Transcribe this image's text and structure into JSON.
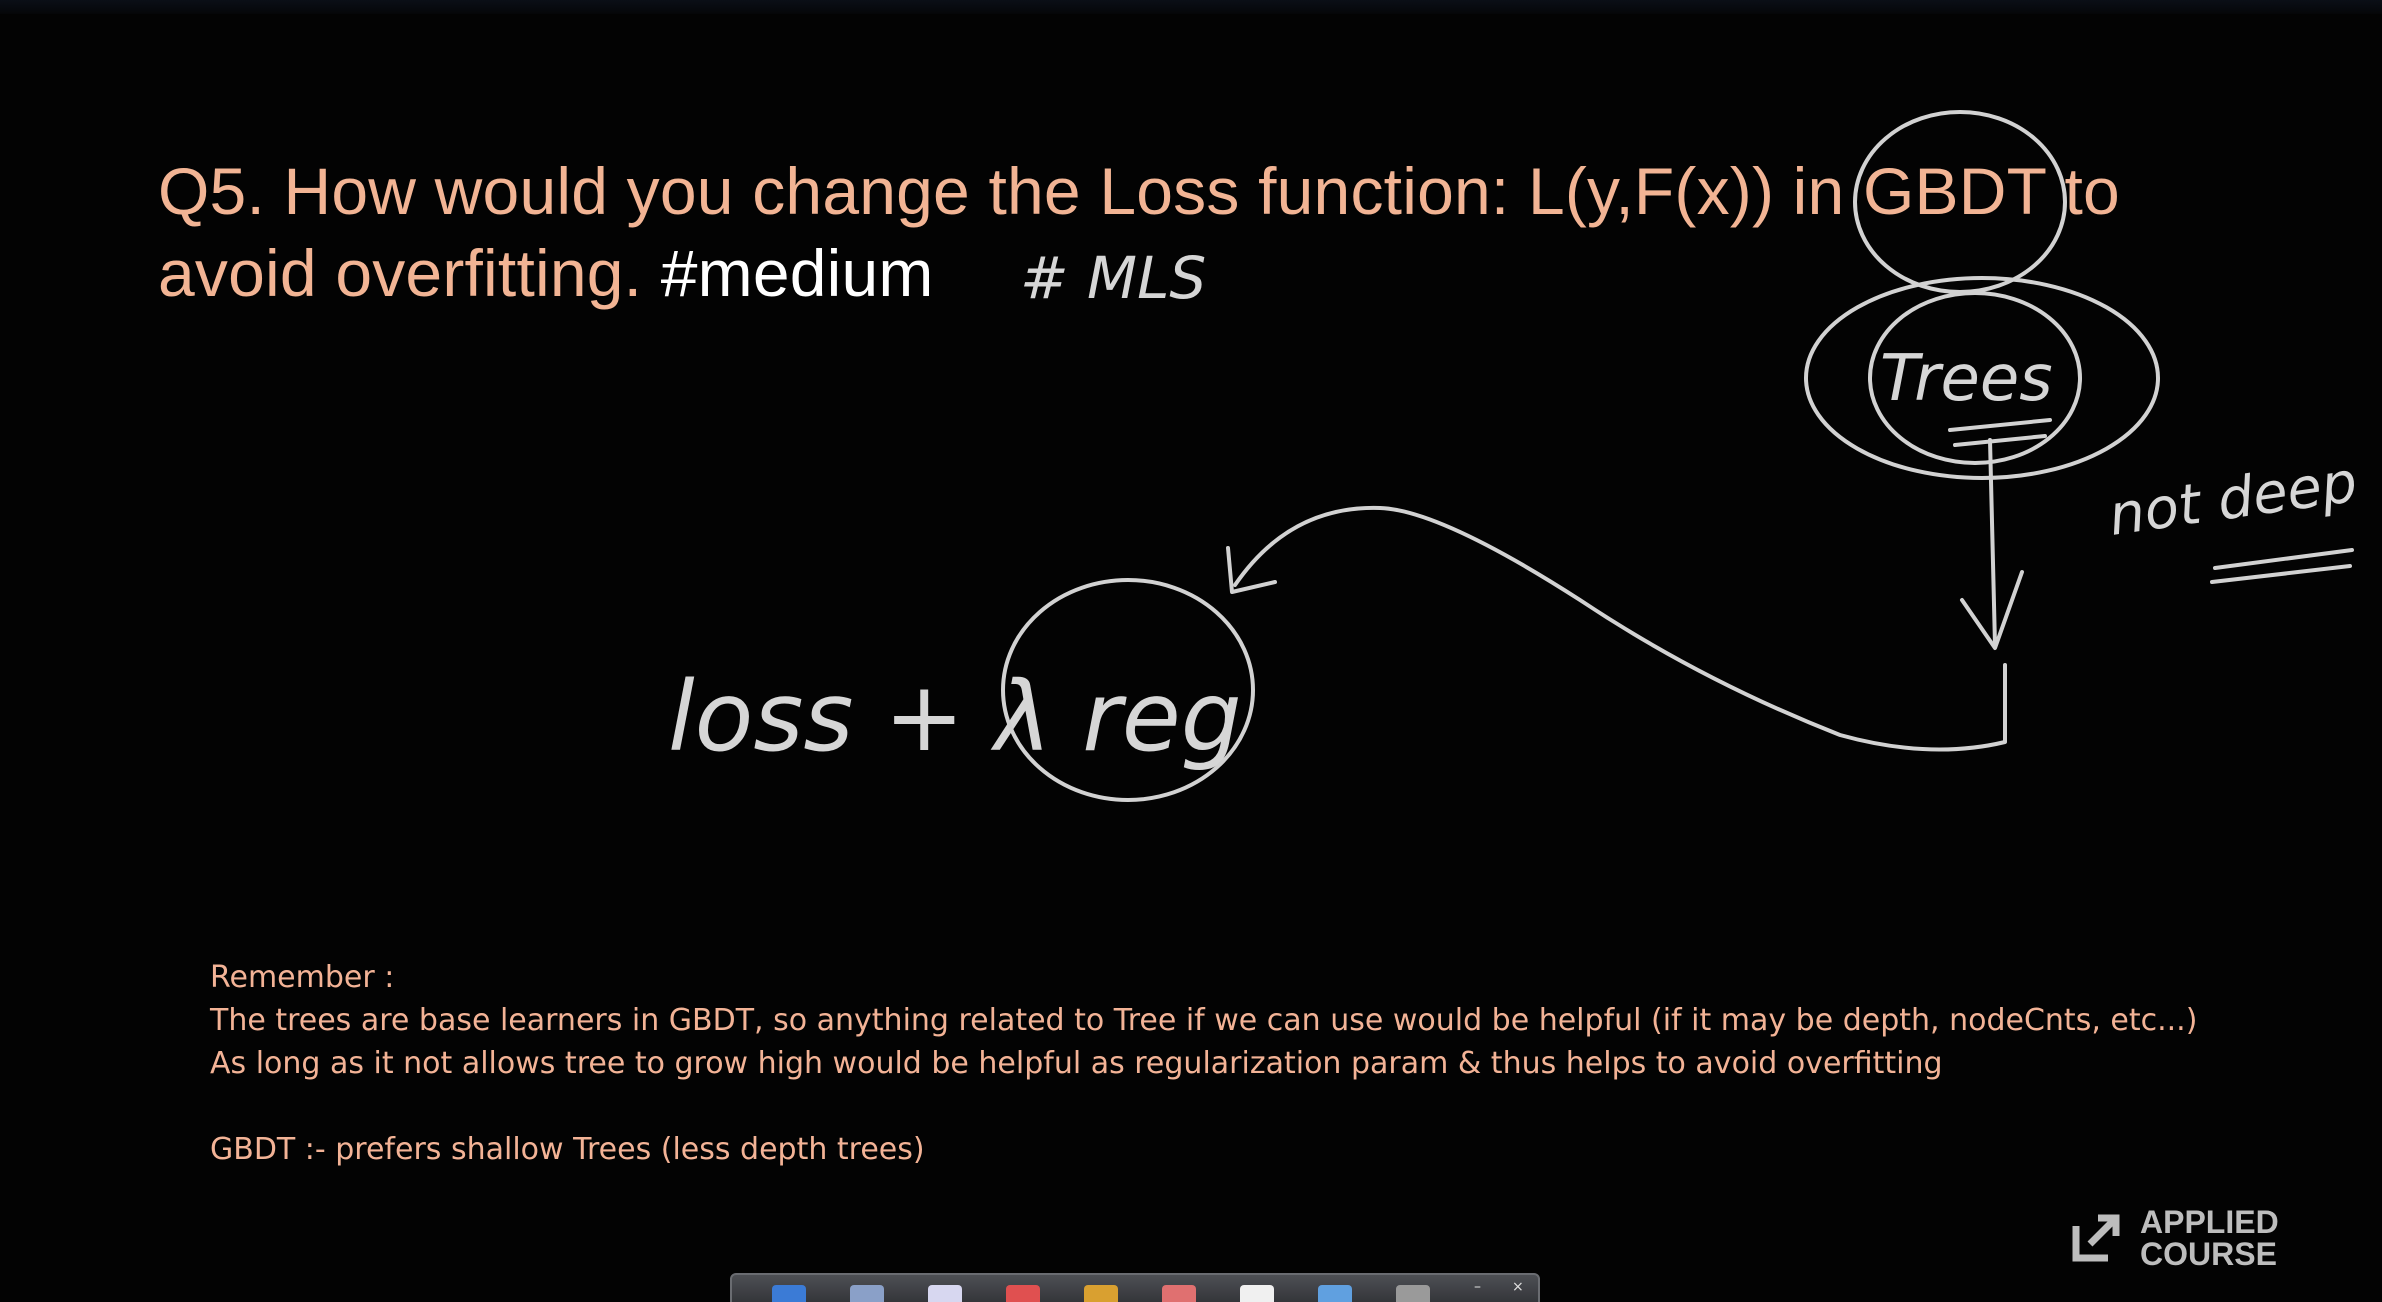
{
  "question": {
    "text": "Q5. How would you change the Loss function: L(y,F(x)) in GBDT to avoid overfitting.",
    "tag": "#medium"
  },
  "annotations": {
    "hashtag": "# MLS",
    "trees": "Trees",
    "not_deep": "not deep",
    "formula": "loss + λ reg"
  },
  "notes": {
    "heading": "Remember :",
    "line1": "The trees are base learners in GBDT, so anything related to Tree if we can use would be helpful (if it may be depth, nodeCnts, etc...)",
    "line2": "As long as it not allows tree to grow high would be helpful as regularization param & thus helps to avoid overfitting",
    "line3": "GBDT :- prefers shallow Trees (less depth trees)"
  },
  "logo": {
    "line1": "APPLIED",
    "line2": "COURSE"
  },
  "dock": {
    "tools": [
      "pen-tool",
      "highlighter-tool",
      "eraser-tool",
      "marker-tool",
      "pencil-tool",
      "shape-tool",
      "whiteboard-tool",
      "laser-tool",
      "settings-tool"
    ],
    "tool_colors": [
      "#3b7bd6",
      "#8aa0c8",
      "#d7d7f0",
      "#e05050",
      "#d9a030",
      "#e07070",
      "#f0f0f0",
      "#60a0e0",
      "#9a9a9a"
    ],
    "minimize": "–",
    "close": "×"
  }
}
